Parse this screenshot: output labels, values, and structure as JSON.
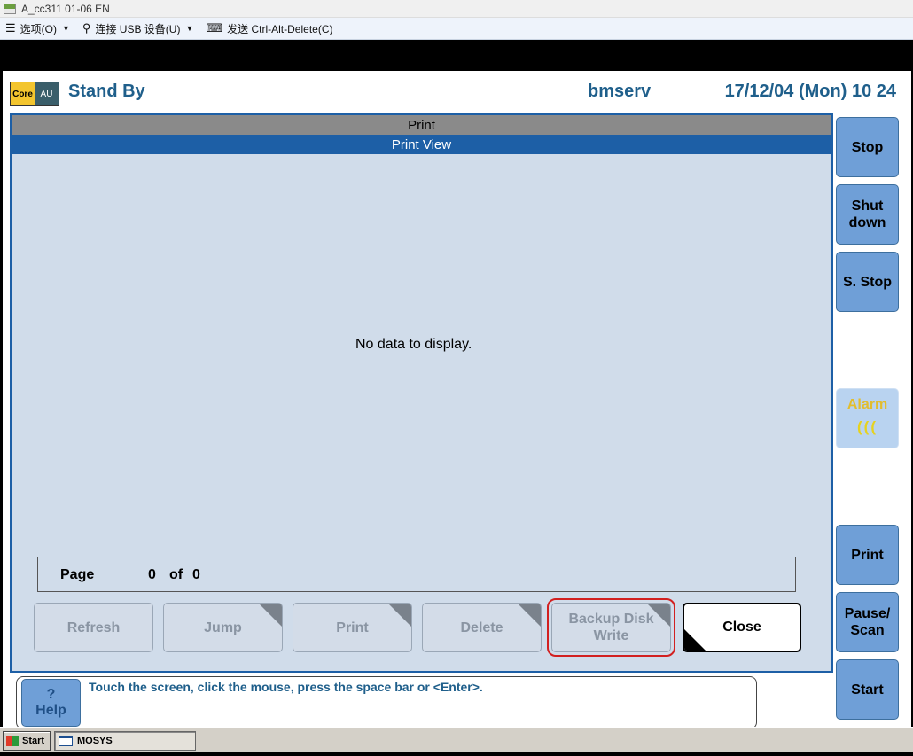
{
  "remote": {
    "window_title": "A_cc311 01-06 EN",
    "menu": [
      {
        "label": "选项(O)",
        "icon": "hamburger-icon"
      },
      {
        "label": "连接 USB 设备(U)",
        "icon": "usb-icon"
      },
      {
        "label": "发送 Ctrl-Alt-Delete(C)",
        "icon": "keyboard-icon"
      }
    ]
  },
  "header": {
    "logo_left": "Core",
    "logo_right": "AU",
    "status": "Stand By",
    "user": "bmserv",
    "datetime": "17/12/04 (Mon) 10 24"
  },
  "panel": {
    "title": "Print",
    "subtitle": "Print View",
    "empty_message": "No data to display.",
    "page": {
      "label": "Page",
      "current": "0",
      "of": "of",
      "total": "0"
    }
  },
  "actions": {
    "refresh": "Refresh",
    "jump": "Jump",
    "print": "Print",
    "delete": "Delete",
    "backup_line1": "Backup Disk",
    "backup_line2": "Write",
    "close": "Close"
  },
  "side_buttons": {
    "stop": "Stop",
    "shutdown_line1": "Shut",
    "shutdown_line2": "down",
    "sstop": "S. Stop",
    "alarm": "Alarm",
    "print": "Print",
    "pause_line1": "Pause/",
    "pause_line2": "Scan",
    "start": "Start"
  },
  "footer": {
    "help_symbol": "?",
    "help_label": "Help",
    "message": "Touch the screen, click the mouse, press the space bar or <Enter>."
  },
  "taskbar": {
    "start": "Start",
    "task": "MOSYS"
  },
  "colors": {
    "brand_blue": "#1d5fa6",
    "text_blue": "#1f5f8b",
    "button_blue": "#6f9fd7",
    "panel_bg": "#d0dcea",
    "highlight_red": "#d22020"
  }
}
